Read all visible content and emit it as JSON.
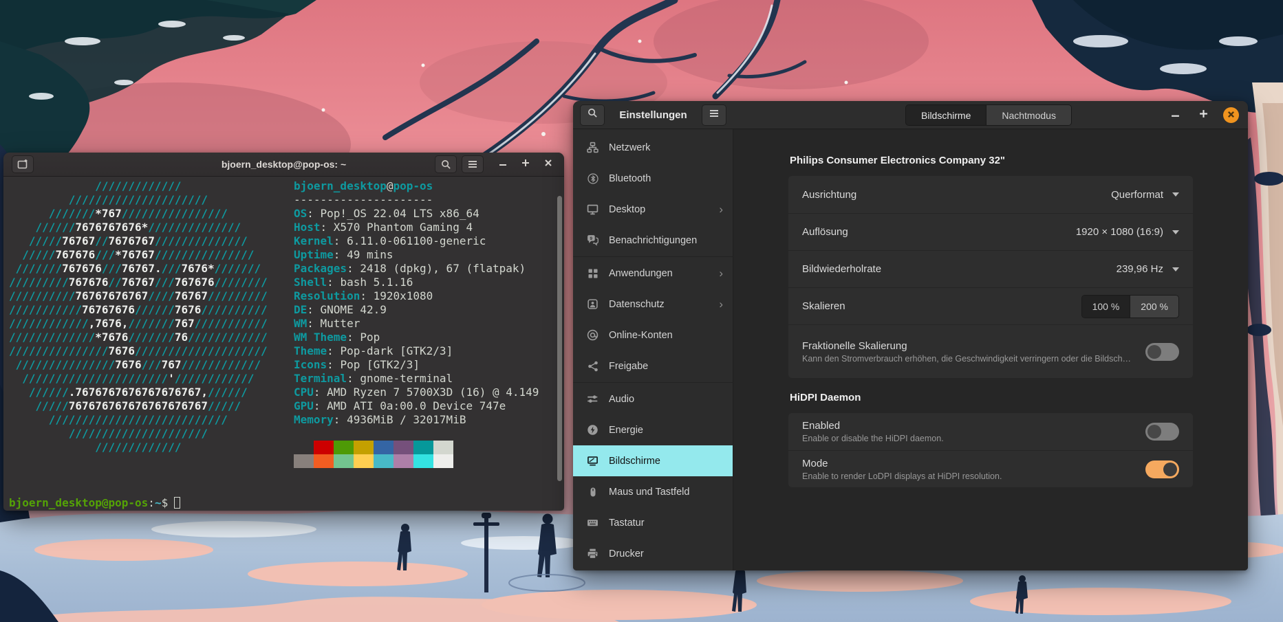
{
  "terminal": {
    "title": "bjoern_desktop@pop-os: ~",
    "ascii_lines": [
      "             /////////////",
      "         /////////////////////",
      "      ///////*767////////////////",
      "    //////7676767676*//////////////",
      "   /////76767//7676767//////////////",
      "  /////767676///*76767///////////////",
      " ///////767676///76767.///7676*///////",
      "/////////767676//76767///767676////////",
      "//////////76767676767////76767/////////",
      "///////////76767676//////7676//////////",
      "////////////,7676,///////767///////////",
      "/////////////*7676///////76////////////",
      "///////////////7676////////////////////",
      " ///////////////7676///767////////////",
      "  //////////////////////'////////////",
      "   //////.7676767676767676767,//////",
      "    /////767676767676767676767/////",
      "      ///////////////////////////",
      "         /////////////////////",
      "             /////////////"
    ],
    "info": {
      "user": "bjoern_desktop",
      "at": "@",
      "host": "pop-os",
      "separator": "---------------------",
      "fields": [
        {
          "label": "OS",
          "value": "Pop!_OS 22.04 LTS x86_64"
        },
        {
          "label": "Host",
          "value": "X570 Phantom Gaming 4"
        },
        {
          "label": "Kernel",
          "value": "6.11.0-061100-generic"
        },
        {
          "label": "Uptime",
          "value": "49 mins"
        },
        {
          "label": "Packages",
          "value": "2418 (dpkg), 67 (flatpak)"
        },
        {
          "label": "Shell",
          "value": "bash 5.1.16"
        },
        {
          "label": "Resolution",
          "value": "1920x1080"
        },
        {
          "label": "DE",
          "value": "GNOME 42.9"
        },
        {
          "label": "WM",
          "value": "Mutter"
        },
        {
          "label": "WM Theme",
          "value": "Pop"
        },
        {
          "label": "Theme",
          "value": "Pop-dark [GTK2/3]"
        },
        {
          "label": "Icons",
          "value": "Pop [GTK2/3]"
        },
        {
          "label": "Terminal",
          "value": "gnome-terminal"
        },
        {
          "label": "CPU",
          "value": "AMD Ryzen 7 5700X3D (16) @ 4.149"
        },
        {
          "label": "GPU",
          "value": "AMD ATI 0a:00.0 Device 747e"
        },
        {
          "label": "Memory",
          "value": "4936MiB / 32017MiB"
        }
      ]
    },
    "palette_row1": [
      "#333132",
      "#cc0000",
      "#4e9a06",
      "#c4a000",
      "#3465a4",
      "#75507b",
      "#06989a",
      "#d3d7cf"
    ],
    "palette_row2": [
      "#88807c",
      "#f15d22",
      "#73c48f",
      "#ffce51",
      "#48b9c7",
      "#ad7fa8",
      "#34e2e2",
      "#eeeeec"
    ],
    "prompt": {
      "user_host": "bjoern_desktop@pop-os",
      "colon": ":",
      "path": "~",
      "dollar": "$"
    }
  },
  "settings": {
    "title": "Einstellungen",
    "tabs": [
      {
        "label": "Bildschirme",
        "active": true
      },
      {
        "label": "Nachtmodus",
        "active": false
      }
    ],
    "sidebar": [
      {
        "label": "Netzwerk",
        "icon": "network-icon"
      },
      {
        "label": "Bluetooth",
        "icon": "bluetooth-icon"
      },
      {
        "label": "Desktop",
        "icon": "desktop-icon",
        "chevron": true
      },
      {
        "label": "Benachrichtigungen",
        "icon": "notifications-icon",
        "separator_after": true
      },
      {
        "label": "Anwendungen",
        "icon": "applications-icon",
        "chevron": true
      },
      {
        "label": "Datenschutz",
        "icon": "privacy-icon",
        "chevron": true
      },
      {
        "label": "Online-Konten",
        "icon": "online-accounts-icon"
      },
      {
        "label": "Freigabe",
        "icon": "sharing-icon",
        "separator_after": true
      },
      {
        "label": "Audio",
        "icon": "audio-icon"
      },
      {
        "label": "Energie",
        "icon": "power-icon"
      },
      {
        "label": "Bildschirme",
        "icon": "displays-icon",
        "selected": true
      },
      {
        "label": "Maus und Tastfeld",
        "icon": "mouse-icon"
      },
      {
        "label": "Tastatur",
        "icon": "keyboard-icon"
      },
      {
        "label": "Drucker",
        "icon": "printer-icon"
      }
    ],
    "display_section": {
      "heading": "Philips Consumer Electronics Company 32\"",
      "rows": [
        {
          "type": "dropdown",
          "label": "Ausrichtung",
          "value": "Querformat"
        },
        {
          "type": "dropdown",
          "label": "Auflösung",
          "value": "1920 × 1080 (16:9)"
        },
        {
          "type": "dropdown",
          "label": "Bildwiederholrate",
          "value": "239,96 Hz"
        },
        {
          "type": "segmented",
          "label": "Skalieren",
          "options": [
            "100 %",
            "200 %"
          ],
          "selected": "100 %"
        },
        {
          "type": "toggle",
          "label": "Fraktionelle Skalierung",
          "subtitle": "Kann den Stromverbrauch erhöhen, die Geschwindigkeit verringern oder die Bildschärfe reduz…",
          "on": false
        }
      ]
    },
    "hidpi_section": {
      "heading": "HiDPI Daemon",
      "rows": [
        {
          "type": "toggle",
          "label": "Enabled",
          "subtitle": "Enable or disable the HiDPI daemon.",
          "on": false
        },
        {
          "type": "toggle",
          "label": "Mode",
          "subtitle": "Enable to render LoDPI displays at HiDPI resolution.",
          "on": true
        }
      ]
    },
    "colors": {
      "accent_selected": "#94e9ed",
      "toggle_on": "#f5a95f",
      "close_button": "#f0941f"
    }
  }
}
